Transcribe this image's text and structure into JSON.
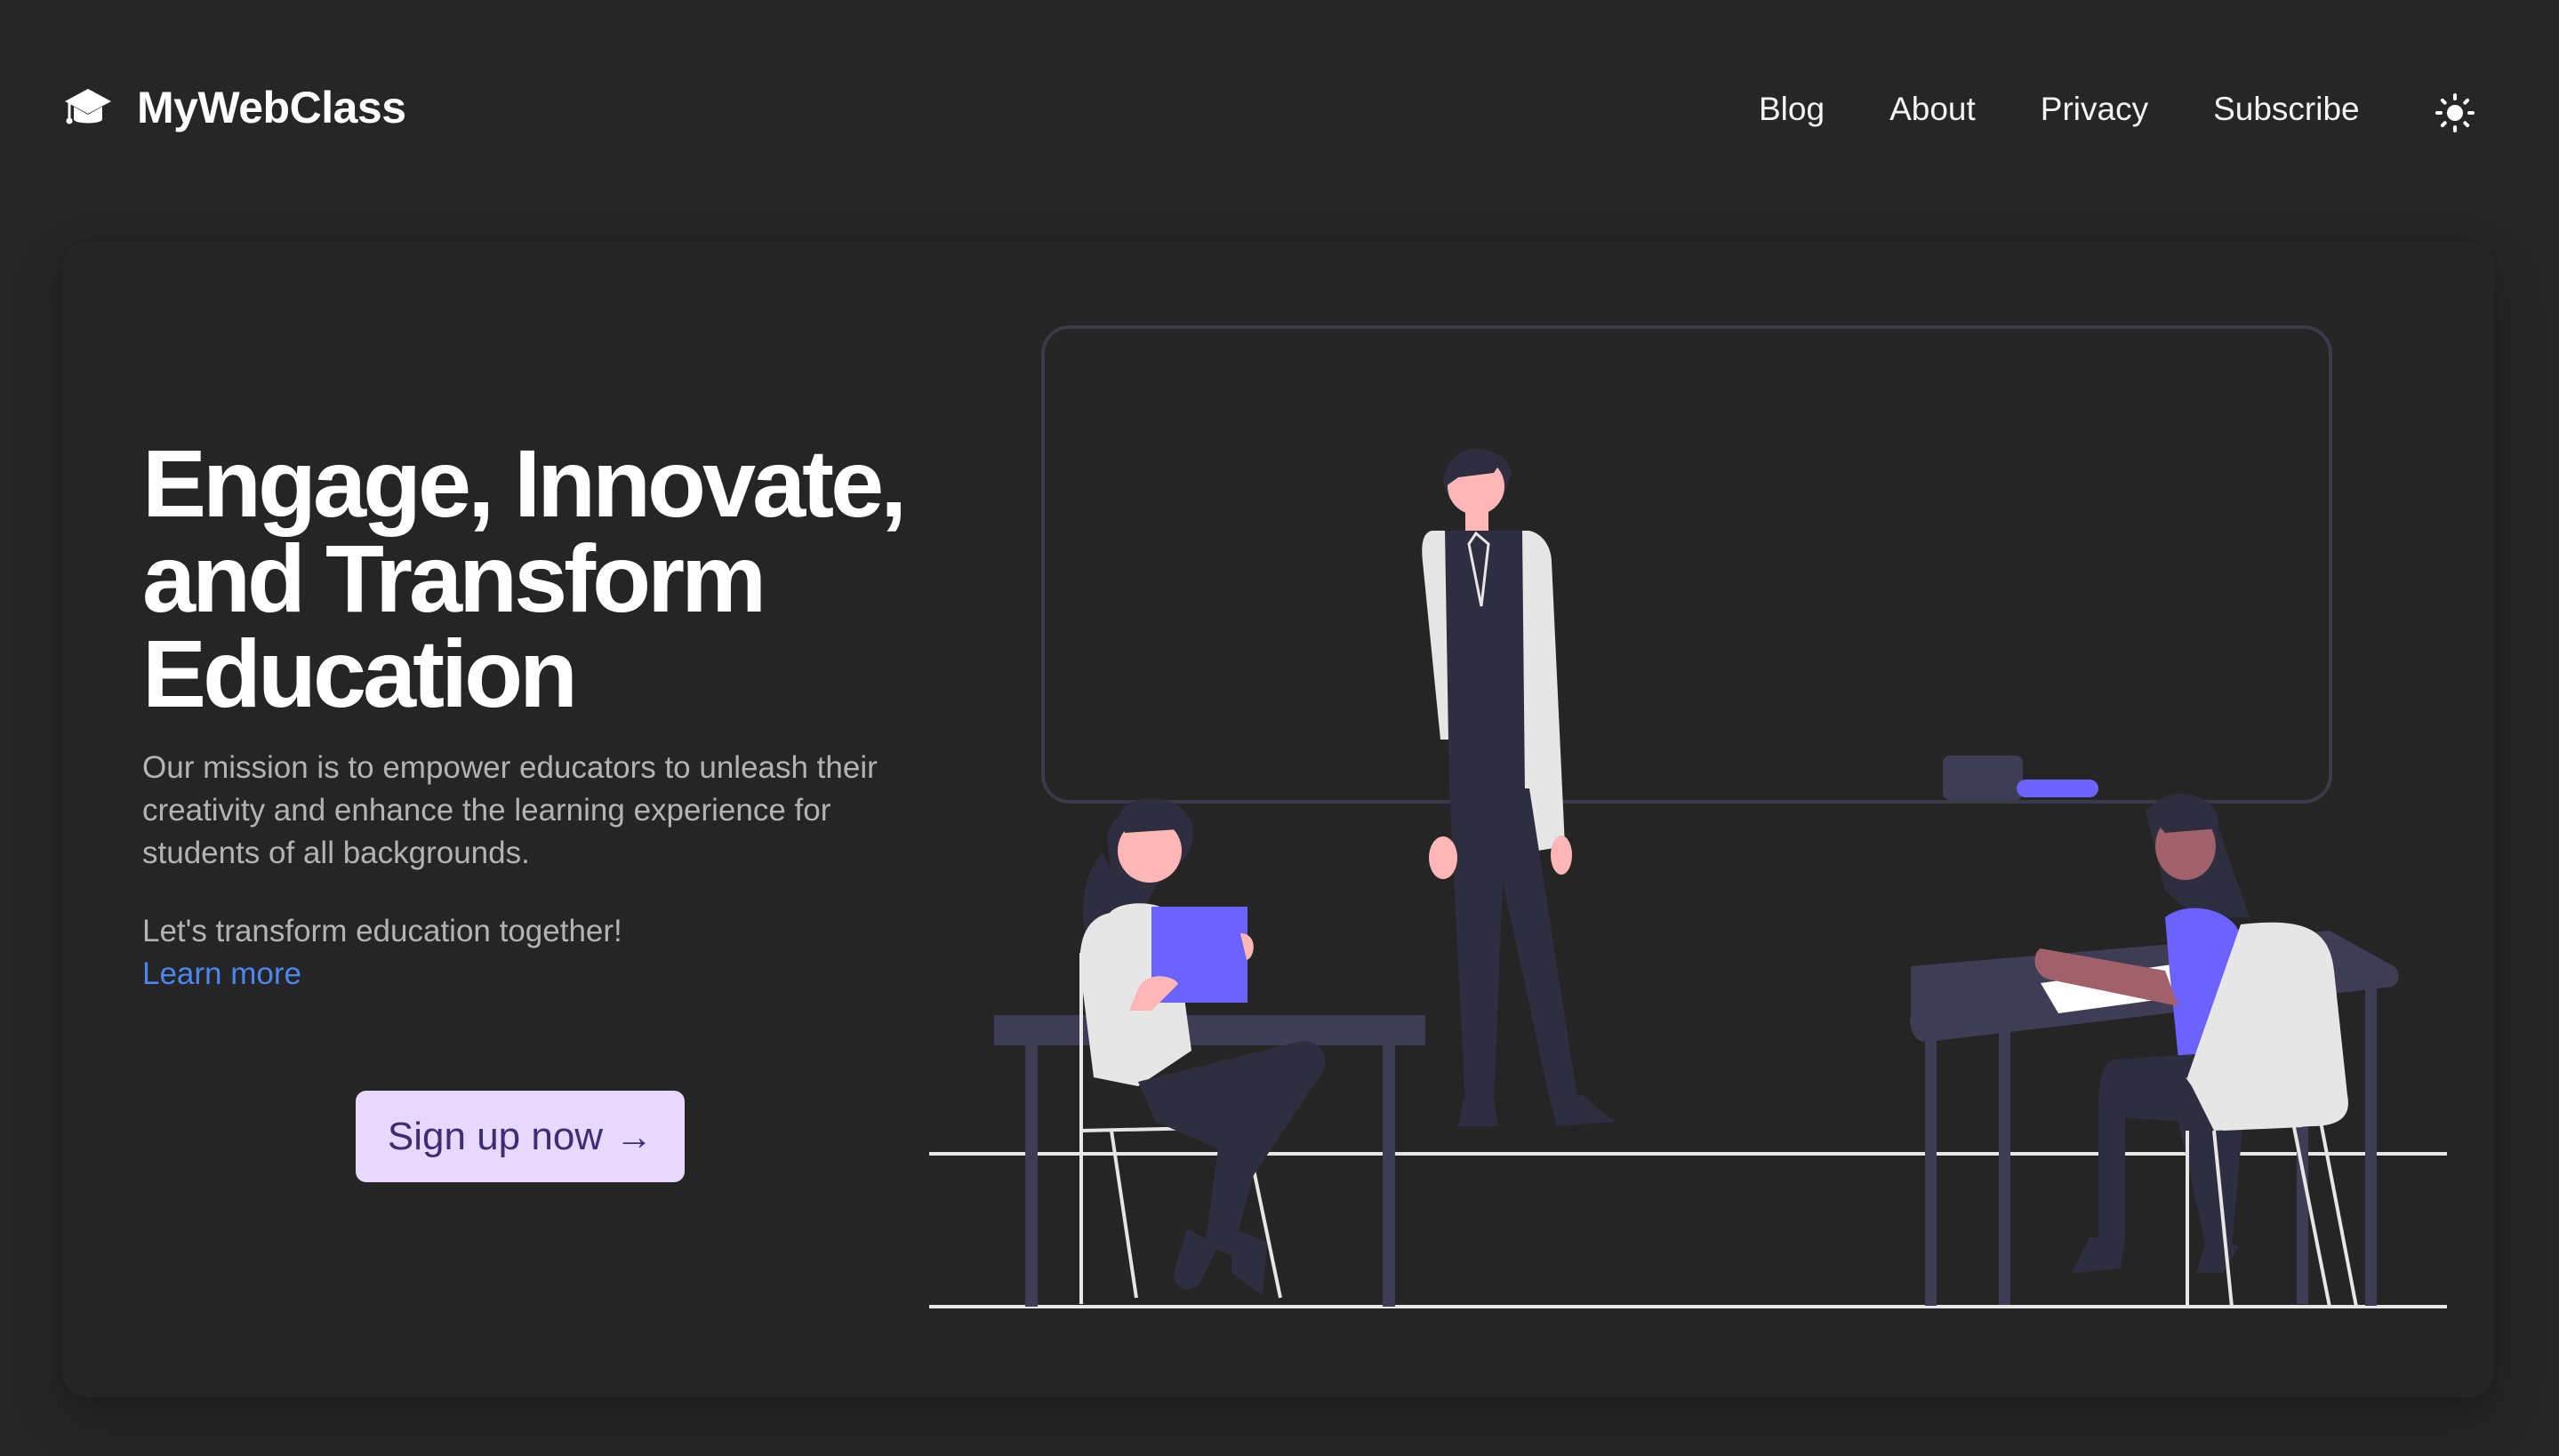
{
  "brand": {
    "name": "MyWebClass",
    "icon": "graduation-cap-icon"
  },
  "nav": {
    "items": [
      {
        "label": "Blog"
      },
      {
        "label": "About"
      },
      {
        "label": "Privacy"
      },
      {
        "label": "Subscribe"
      }
    ],
    "theme_toggle_icon": "sun-icon"
  },
  "hero": {
    "headline": "Engage, Innovate, and Transform Education",
    "mission": "Our mission is to empower educators to unleash their creativity and enhance the learning experience for students of all backgrounds.",
    "together": "Let's transform education together!",
    "learn_more": "Learn more",
    "cta_label": "Sign up now",
    "cta_icon": "arrow-right-icon"
  },
  "colors": {
    "background": "#262626",
    "card": "#252525",
    "link": "#4c86f0",
    "cta_background": "#e8d8ff",
    "cta_text": "#3f2c75",
    "accent": "#6c63ff"
  }
}
